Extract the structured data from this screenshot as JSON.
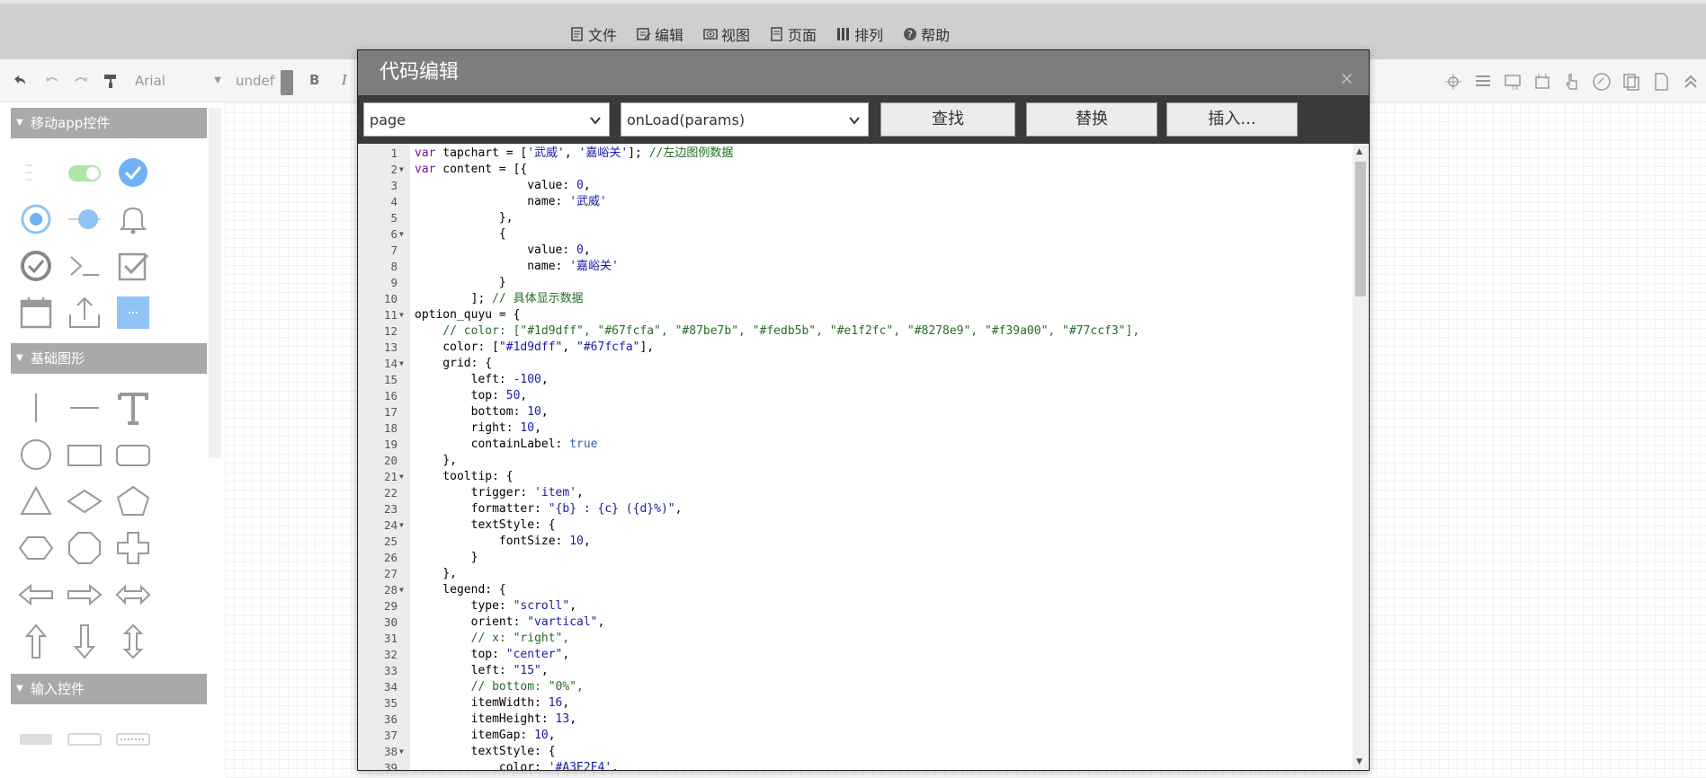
{
  "menu": {
    "items": [
      {
        "label": "文件",
        "icon": "file-icon"
      },
      {
        "label": "编辑",
        "icon": "edit-icon"
      },
      {
        "label": "视图",
        "icon": "eye-icon"
      },
      {
        "label": "页面",
        "icon": "page-icon"
      },
      {
        "label": "排列",
        "icon": "arrange-icon"
      },
      {
        "label": "帮助",
        "icon": "help-icon"
      }
    ]
  },
  "toolbar": {
    "font_family": "Arial",
    "font_size": "undefin",
    "bold_label": "B",
    "italic_label": "I"
  },
  "sidebar": {
    "sections": [
      {
        "title": "移动app控件"
      },
      {
        "title": "基础图形"
      },
      {
        "title": "输入控件"
      }
    ]
  },
  "modal": {
    "title": "代码编辑",
    "close_label": "×",
    "scope_select": "page",
    "event_select": "onLoad(params)",
    "find_label": "查找",
    "replace_label": "替换",
    "insert_label": "插入..."
  },
  "colors": {
    "menubar": "#cfcfcf",
    "modal_title": "#7d7d7d",
    "modal_body": "#3a3a3a",
    "section_header": "#a9a9a9",
    "accent_blue": "#8fc4f5"
  },
  "code": {
    "lines": [
      {
        "n": "1",
        "fold": "",
        "html": "<span class=\"kw\">var</span> tapchart = [<span class=\"str\">'武威'</span>, <span class=\"str\">'嘉峪关'</span>]; <span class=\"cm\">//左边图例数据</span>"
      },
      {
        "n": "2",
        "fold": "▼",
        "html": "<span class=\"kw\">var</span> content = [{"
      },
      {
        "n": "3",
        "fold": "",
        "html": "                value: <span class=\"num\">0</span>,"
      },
      {
        "n": "4",
        "fold": "",
        "html": "                name: <span class=\"str\">'武威'</span>"
      },
      {
        "n": "5",
        "fold": "",
        "html": "            },"
      },
      {
        "n": "6",
        "fold": "▼",
        "html": "            {"
      },
      {
        "n": "7",
        "fold": "",
        "html": "                value: <span class=\"num\">0</span>,"
      },
      {
        "n": "8",
        "fold": "",
        "html": "                name: <span class=\"str\">'嘉峪关'</span>"
      },
      {
        "n": "9",
        "fold": "",
        "html": "            }"
      },
      {
        "n": "10",
        "fold": "",
        "html": "        ]; <span class=\"cm\">// 具体显示数据</span>"
      },
      {
        "n": "11",
        "fold": "▼",
        "html": "option_quyu = {"
      },
      {
        "n": "12",
        "fold": "",
        "html": "    <span class=\"cm\">// color: [\"#1d9dff\", \"#67fcfa\", \"#87be7b\", \"#fedb5b\", \"#e1f2fc\", \"#8278e9\", \"#f39a00\", \"#77ccf3\"],</span>"
      },
      {
        "n": "13",
        "fold": "",
        "html": "    color: [<span class=\"str\">\"#1d9dff\"</span>, <span class=\"str\">\"#67fcfa\"</span>],"
      },
      {
        "n": "14",
        "fold": "▼",
        "html": "    grid: {"
      },
      {
        "n": "15",
        "fold": "",
        "html": "        left: <span class=\"num\">-100</span>,"
      },
      {
        "n": "16",
        "fold": "",
        "html": "        top: <span class=\"num\">50</span>,"
      },
      {
        "n": "17",
        "fold": "",
        "html": "        bottom: <span class=\"num\">10</span>,"
      },
      {
        "n": "18",
        "fold": "",
        "html": "        right: <span class=\"num\">10</span>,"
      },
      {
        "n": "19",
        "fold": "",
        "html": "        containLabel: <span class=\"bool\">true</span>"
      },
      {
        "n": "20",
        "fold": "",
        "html": "    },"
      },
      {
        "n": "21",
        "fold": "▼",
        "html": "    tooltip: {"
      },
      {
        "n": "22",
        "fold": "",
        "html": "        trigger: <span class=\"str\">'item'</span>,"
      },
      {
        "n": "23",
        "fold": "",
        "html": "        formatter: <span class=\"str\">\"{b} : {c} ({d}%)\"</span>,"
      },
      {
        "n": "24",
        "fold": "▼",
        "html": "        textStyle: {"
      },
      {
        "n": "25",
        "fold": "",
        "html": "            fontSize: <span class=\"num\">10</span>,"
      },
      {
        "n": "26",
        "fold": "",
        "html": "        }"
      },
      {
        "n": "27",
        "fold": "",
        "html": "    },"
      },
      {
        "n": "28",
        "fold": "▼",
        "html": "    legend: {"
      },
      {
        "n": "29",
        "fold": "",
        "html": "        type: <span class=\"str\">\"scroll\"</span>,"
      },
      {
        "n": "30",
        "fold": "",
        "html": "        orient: <span class=\"str\">\"vartical\"</span>,"
      },
      {
        "n": "31",
        "fold": "",
        "html": "        <span class=\"cm\">// x: \"right\",</span>"
      },
      {
        "n": "32",
        "fold": "",
        "html": "        top: <span class=\"str\">\"center\"</span>,"
      },
      {
        "n": "33",
        "fold": "",
        "html": "        left: <span class=\"str\">\"15\"</span>,"
      },
      {
        "n": "34",
        "fold": "",
        "html": "        <span class=\"cm\">// bottom: \"0%\",</span>"
      },
      {
        "n": "35",
        "fold": "",
        "html": "        itemWidth: <span class=\"num\">16</span>,"
      },
      {
        "n": "36",
        "fold": "",
        "html": "        itemHeight: <span class=\"num\">13</span>,"
      },
      {
        "n": "37",
        "fold": "",
        "html": "        itemGap: <span class=\"num\">10</span>,"
      },
      {
        "n": "38",
        "fold": "▼",
        "html": "        textStyle: {"
      },
      {
        "n": "39",
        "fold": "",
        "html": "            color: <span class=\"str\">'#A3E2F4'</span>,"
      }
    ]
  }
}
